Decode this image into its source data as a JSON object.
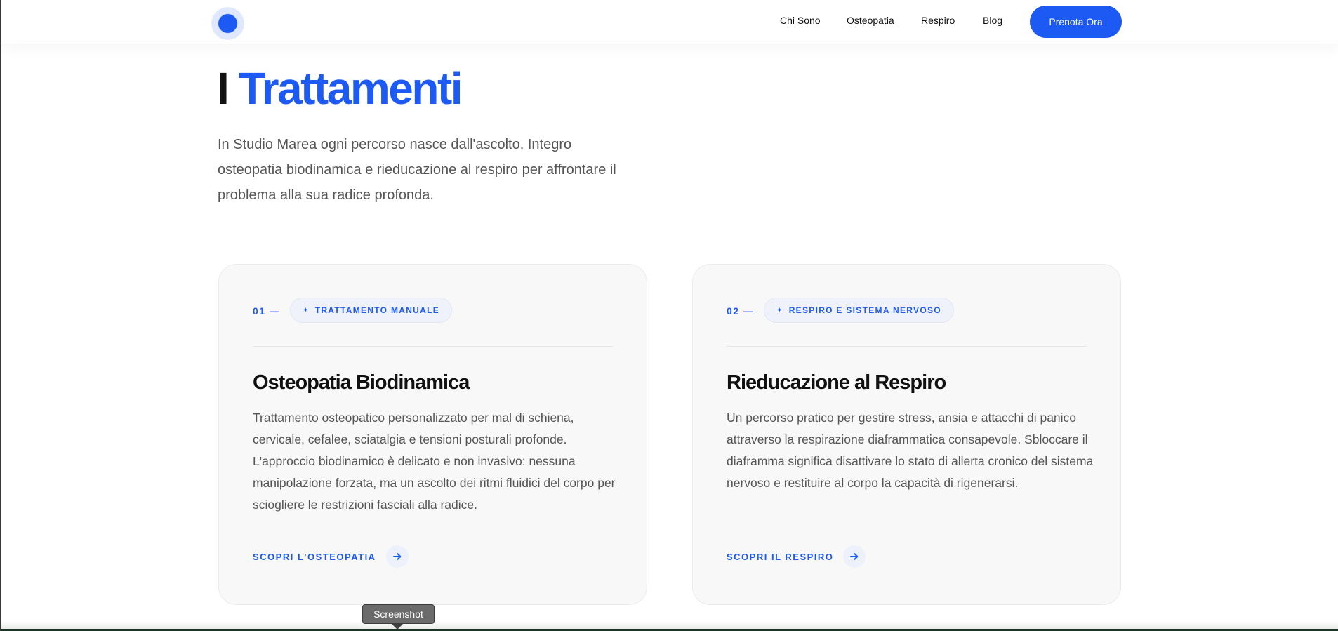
{
  "header": {
    "nav": [
      "Chi Sono",
      "Osteopatia",
      "Respiro",
      "Blog"
    ],
    "cta_label": "Prenota Ora"
  },
  "hero": {
    "title_prefix": "I",
    "title_accent": "Trattamenti",
    "intro": "In Studio Marea ogni percorso nasce dall'ascolto. Integro osteopatia biodinamica e rieducazione al respiro per affrontare il problema alla sua radice profonda."
  },
  "cards": [
    {
      "number": "01 —",
      "tag": "TRATTAMENTO MANUALE",
      "title": "Osteopatia Biodinamica",
      "body": "Trattamento osteopatico personalizzato per mal di schiena, cervicale, cefalee, sciatalgia e tensioni posturali profonde. L'approccio biodinamico è delicato e non invasivo: nessuna manipolazione forzata, ma un ascolto dei ritmi fluidici del corpo per sciogliere le restrizioni fasciali alla radice.",
      "link": "SCOPRI L'OSTEOPATIA"
    },
    {
      "number": "02 —",
      "tag": "RESPIRO E SISTEMA NERVOSO",
      "title": "Rieducazione al Respiro",
      "body": "Un percorso pratico per gestire stress, ansia e attacchi di panico attraverso la respirazione diaframmatica consapevole. Sbloccare il diaframma significa disattivare lo stato di allerta cronico del sistema nervoso e restituire al corpo la capacità di rigenerarsi.",
      "link": "SCOPRI IL RESPIRO"
    }
  ],
  "tooltip": "Screenshot",
  "icons": {
    "tag_icon": "sparkle-icon",
    "link_icon": "arrow-right-icon",
    "logo": "logo-dot"
  },
  "colors": {
    "accent": "#1d5af4",
    "text": "#111111",
    "muted": "#555555",
    "card_bg": "#f8f8f9"
  }
}
